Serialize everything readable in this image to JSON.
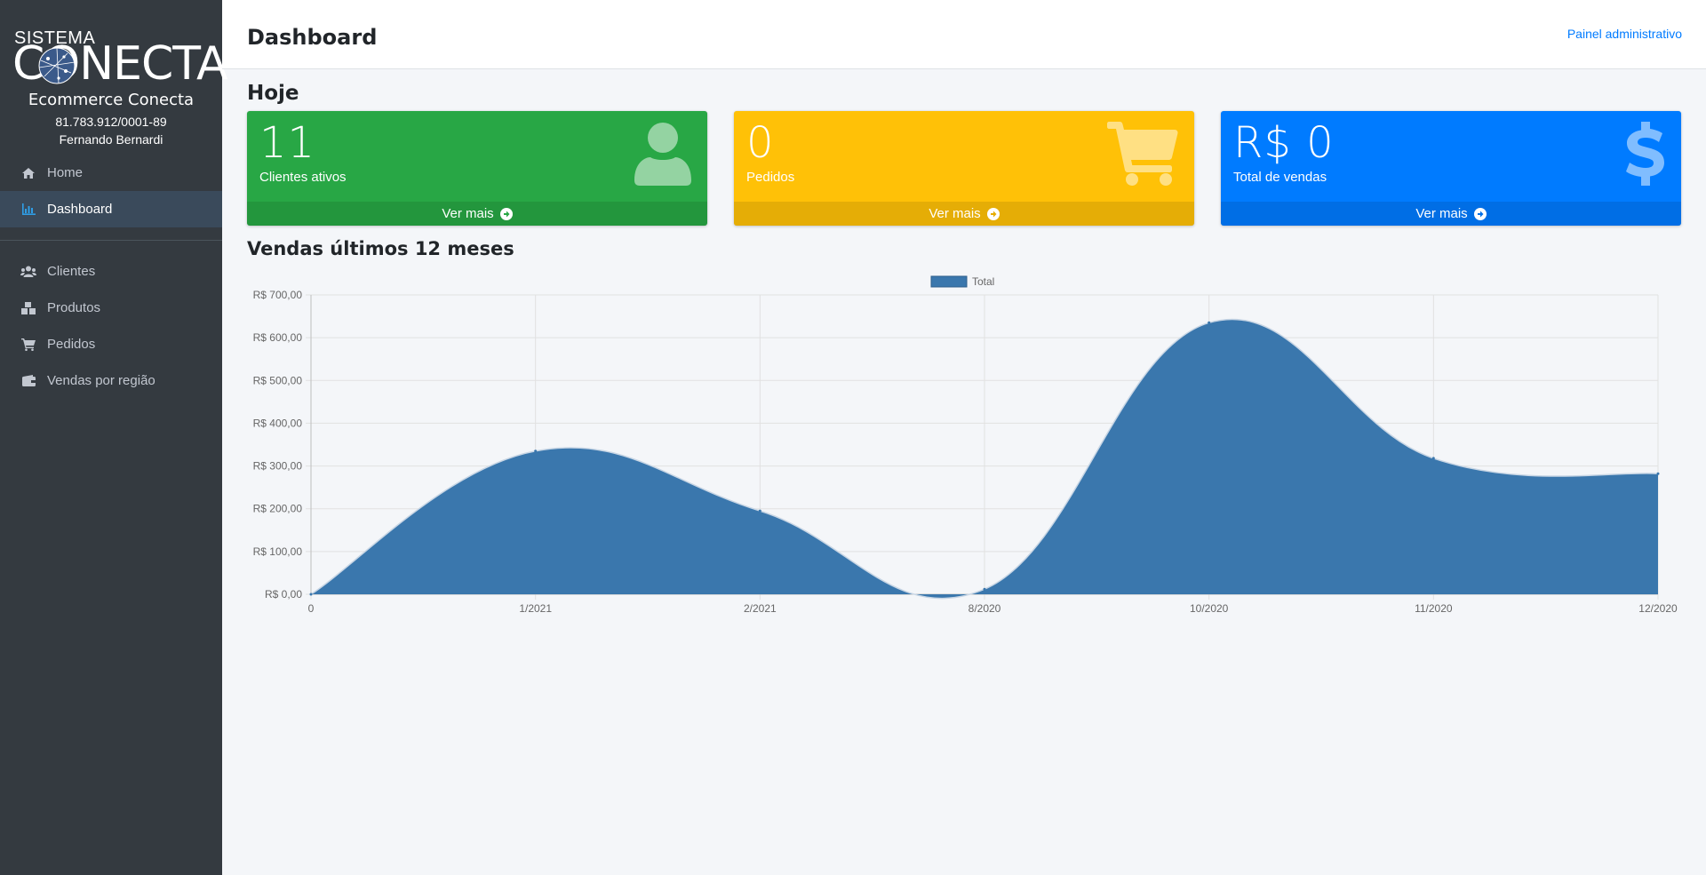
{
  "brand": {
    "logo_top": "SISTEMA",
    "logo_main": "CONECTA",
    "name": "Ecommerce Conecta",
    "cnpj": "81.783.912/0001-89",
    "user": "Fernando Bernardi"
  },
  "sidebar": {
    "items": [
      {
        "label": "Home",
        "icon": "home-icon"
      },
      {
        "label": "Dashboard",
        "icon": "chart-bar-icon",
        "active": true
      },
      {
        "label": "Clientes",
        "icon": "users-icon"
      },
      {
        "label": "Produtos",
        "icon": "boxes-icon"
      },
      {
        "label": "Pedidos",
        "icon": "cart-icon"
      },
      {
        "label": "Vendas por região",
        "icon": "wallet-icon"
      }
    ]
  },
  "header": {
    "title": "Dashboard",
    "admin_link": "Painel administrativo"
  },
  "today": {
    "title": "Hoje",
    "cards": [
      {
        "value": "11",
        "label": "Clientes ativos",
        "footer": "Ver mais",
        "color": "#28a745",
        "icon": "user-icon"
      },
      {
        "value": "0",
        "label": "Pedidos",
        "footer": "Ver mais",
        "color": "#ffc107",
        "icon": "shopping-cart-icon"
      },
      {
        "value": "R$ 0",
        "label": "Total de vendas",
        "footer": "Ver mais",
        "color": "#007bff",
        "icon": "dollar-icon"
      }
    ]
  },
  "sales": {
    "title": "Vendas últimos 12 meses"
  },
  "chart_data": {
    "type": "area",
    "categories": [
      "0",
      "1/2021",
      "2/2021",
      "8/2020",
      "10/2020",
      "11/2020",
      "12/2020"
    ],
    "series": [
      {
        "name": "Total",
        "values": [
          0,
          335,
          195,
          12,
          635,
          318,
          282
        ],
        "color": "#3a77ad"
      }
    ],
    "yticks": [
      "R$ 0,00",
      "R$ 100,00",
      "R$ 200,00",
      "R$ 300,00",
      "R$ 400,00",
      "R$ 500,00",
      "R$ 600,00",
      "R$ 700,00"
    ],
    "ylim": [
      0,
      700
    ],
    "grid": true,
    "legend": "top-center"
  }
}
